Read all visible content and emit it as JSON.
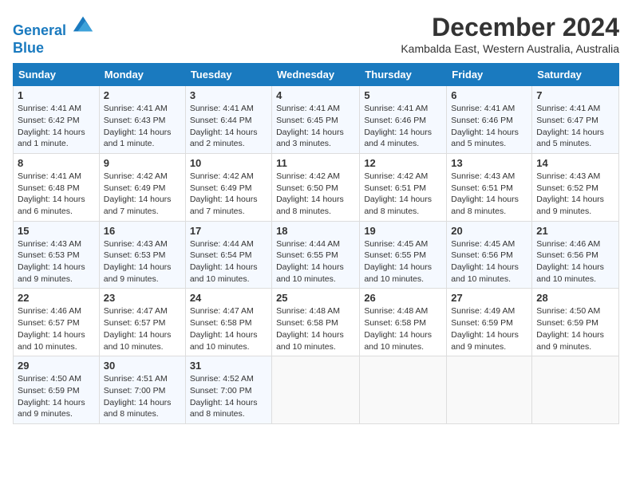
{
  "header": {
    "logo_line1": "General",
    "logo_line2": "Blue",
    "month": "December 2024",
    "location": "Kambalda East, Western Australia, Australia"
  },
  "days_of_week": [
    "Sunday",
    "Monday",
    "Tuesday",
    "Wednesday",
    "Thursday",
    "Friday",
    "Saturday"
  ],
  "weeks": [
    [
      {
        "day": "1",
        "info": "Sunrise: 4:41 AM\nSunset: 6:42 PM\nDaylight: 14 hours\nand 1 minute."
      },
      {
        "day": "2",
        "info": "Sunrise: 4:41 AM\nSunset: 6:43 PM\nDaylight: 14 hours\nand 1 minute."
      },
      {
        "day": "3",
        "info": "Sunrise: 4:41 AM\nSunset: 6:44 PM\nDaylight: 14 hours\nand 2 minutes."
      },
      {
        "day": "4",
        "info": "Sunrise: 4:41 AM\nSunset: 6:45 PM\nDaylight: 14 hours\nand 3 minutes."
      },
      {
        "day": "5",
        "info": "Sunrise: 4:41 AM\nSunset: 6:46 PM\nDaylight: 14 hours\nand 4 minutes."
      },
      {
        "day": "6",
        "info": "Sunrise: 4:41 AM\nSunset: 6:46 PM\nDaylight: 14 hours\nand 5 minutes."
      },
      {
        "day": "7",
        "info": "Sunrise: 4:41 AM\nSunset: 6:47 PM\nDaylight: 14 hours\nand 5 minutes."
      }
    ],
    [
      {
        "day": "8",
        "info": "Sunrise: 4:41 AM\nSunset: 6:48 PM\nDaylight: 14 hours\nand 6 minutes."
      },
      {
        "day": "9",
        "info": "Sunrise: 4:42 AM\nSunset: 6:49 PM\nDaylight: 14 hours\nand 7 minutes."
      },
      {
        "day": "10",
        "info": "Sunrise: 4:42 AM\nSunset: 6:49 PM\nDaylight: 14 hours\nand 7 minutes."
      },
      {
        "day": "11",
        "info": "Sunrise: 4:42 AM\nSunset: 6:50 PM\nDaylight: 14 hours\nand 8 minutes."
      },
      {
        "day": "12",
        "info": "Sunrise: 4:42 AM\nSunset: 6:51 PM\nDaylight: 14 hours\nand 8 minutes."
      },
      {
        "day": "13",
        "info": "Sunrise: 4:43 AM\nSunset: 6:51 PM\nDaylight: 14 hours\nand 8 minutes."
      },
      {
        "day": "14",
        "info": "Sunrise: 4:43 AM\nSunset: 6:52 PM\nDaylight: 14 hours\nand 9 minutes."
      }
    ],
    [
      {
        "day": "15",
        "info": "Sunrise: 4:43 AM\nSunset: 6:53 PM\nDaylight: 14 hours\nand 9 minutes."
      },
      {
        "day": "16",
        "info": "Sunrise: 4:43 AM\nSunset: 6:53 PM\nDaylight: 14 hours\nand 9 minutes."
      },
      {
        "day": "17",
        "info": "Sunrise: 4:44 AM\nSunset: 6:54 PM\nDaylight: 14 hours\nand 10 minutes."
      },
      {
        "day": "18",
        "info": "Sunrise: 4:44 AM\nSunset: 6:55 PM\nDaylight: 14 hours\nand 10 minutes."
      },
      {
        "day": "19",
        "info": "Sunrise: 4:45 AM\nSunset: 6:55 PM\nDaylight: 14 hours\nand 10 minutes."
      },
      {
        "day": "20",
        "info": "Sunrise: 4:45 AM\nSunset: 6:56 PM\nDaylight: 14 hours\nand 10 minutes."
      },
      {
        "day": "21",
        "info": "Sunrise: 4:46 AM\nSunset: 6:56 PM\nDaylight: 14 hours\nand 10 minutes."
      }
    ],
    [
      {
        "day": "22",
        "info": "Sunrise: 4:46 AM\nSunset: 6:57 PM\nDaylight: 14 hours\nand 10 minutes."
      },
      {
        "day": "23",
        "info": "Sunrise: 4:47 AM\nSunset: 6:57 PM\nDaylight: 14 hours\nand 10 minutes."
      },
      {
        "day": "24",
        "info": "Sunrise: 4:47 AM\nSunset: 6:58 PM\nDaylight: 14 hours\nand 10 minutes."
      },
      {
        "day": "25",
        "info": "Sunrise: 4:48 AM\nSunset: 6:58 PM\nDaylight: 14 hours\nand 10 minutes."
      },
      {
        "day": "26",
        "info": "Sunrise: 4:48 AM\nSunset: 6:58 PM\nDaylight: 14 hours\nand 10 minutes."
      },
      {
        "day": "27",
        "info": "Sunrise: 4:49 AM\nSunset: 6:59 PM\nDaylight: 14 hours\nand 9 minutes."
      },
      {
        "day": "28",
        "info": "Sunrise: 4:50 AM\nSunset: 6:59 PM\nDaylight: 14 hours\nand 9 minutes."
      }
    ],
    [
      {
        "day": "29",
        "info": "Sunrise: 4:50 AM\nSunset: 6:59 PM\nDaylight: 14 hours\nand 9 minutes."
      },
      {
        "day": "30",
        "info": "Sunrise: 4:51 AM\nSunset: 7:00 PM\nDaylight: 14 hours\nand 8 minutes."
      },
      {
        "day": "31",
        "info": "Sunrise: 4:52 AM\nSunset: 7:00 PM\nDaylight: 14 hours\nand 8 minutes."
      },
      null,
      null,
      null,
      null
    ]
  ]
}
